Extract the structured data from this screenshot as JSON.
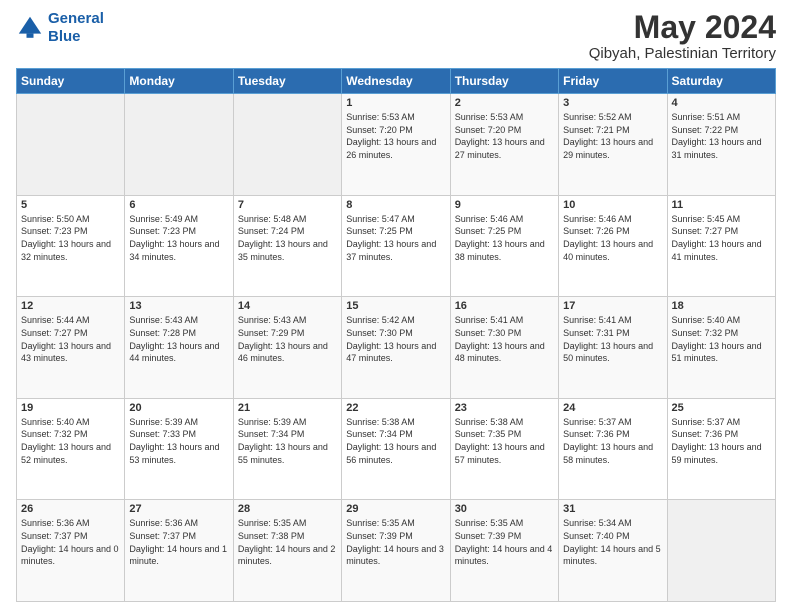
{
  "logo": {
    "line1": "General",
    "line2": "Blue"
  },
  "title": "May 2024",
  "subtitle": "Qibyah, Palestinian Territory",
  "days_header": [
    "Sunday",
    "Monday",
    "Tuesday",
    "Wednesday",
    "Thursday",
    "Friday",
    "Saturday"
  ],
  "weeks": [
    [
      {
        "day": "",
        "sunrise": "",
        "sunset": "",
        "daylight": ""
      },
      {
        "day": "",
        "sunrise": "",
        "sunset": "",
        "daylight": ""
      },
      {
        "day": "",
        "sunrise": "",
        "sunset": "",
        "daylight": ""
      },
      {
        "day": "1",
        "sunrise": "Sunrise: 5:53 AM",
        "sunset": "Sunset: 7:20 PM",
        "daylight": "Daylight: 13 hours and 26 minutes."
      },
      {
        "day": "2",
        "sunrise": "Sunrise: 5:53 AM",
        "sunset": "Sunset: 7:20 PM",
        "daylight": "Daylight: 13 hours and 27 minutes."
      },
      {
        "day": "3",
        "sunrise": "Sunrise: 5:52 AM",
        "sunset": "Sunset: 7:21 PM",
        "daylight": "Daylight: 13 hours and 29 minutes."
      },
      {
        "day": "4",
        "sunrise": "Sunrise: 5:51 AM",
        "sunset": "Sunset: 7:22 PM",
        "daylight": "Daylight: 13 hours and 31 minutes."
      }
    ],
    [
      {
        "day": "5",
        "sunrise": "Sunrise: 5:50 AM",
        "sunset": "Sunset: 7:23 PM",
        "daylight": "Daylight: 13 hours and 32 minutes."
      },
      {
        "day": "6",
        "sunrise": "Sunrise: 5:49 AM",
        "sunset": "Sunset: 7:23 PM",
        "daylight": "Daylight: 13 hours and 34 minutes."
      },
      {
        "day": "7",
        "sunrise": "Sunrise: 5:48 AM",
        "sunset": "Sunset: 7:24 PM",
        "daylight": "Daylight: 13 hours and 35 minutes."
      },
      {
        "day": "8",
        "sunrise": "Sunrise: 5:47 AM",
        "sunset": "Sunset: 7:25 PM",
        "daylight": "Daylight: 13 hours and 37 minutes."
      },
      {
        "day": "9",
        "sunrise": "Sunrise: 5:46 AM",
        "sunset": "Sunset: 7:25 PM",
        "daylight": "Daylight: 13 hours and 38 minutes."
      },
      {
        "day": "10",
        "sunrise": "Sunrise: 5:46 AM",
        "sunset": "Sunset: 7:26 PM",
        "daylight": "Daylight: 13 hours and 40 minutes."
      },
      {
        "day": "11",
        "sunrise": "Sunrise: 5:45 AM",
        "sunset": "Sunset: 7:27 PM",
        "daylight": "Daylight: 13 hours and 41 minutes."
      }
    ],
    [
      {
        "day": "12",
        "sunrise": "Sunrise: 5:44 AM",
        "sunset": "Sunset: 7:27 PM",
        "daylight": "Daylight: 13 hours and 43 minutes."
      },
      {
        "day": "13",
        "sunrise": "Sunrise: 5:43 AM",
        "sunset": "Sunset: 7:28 PM",
        "daylight": "Daylight: 13 hours and 44 minutes."
      },
      {
        "day": "14",
        "sunrise": "Sunrise: 5:43 AM",
        "sunset": "Sunset: 7:29 PM",
        "daylight": "Daylight: 13 hours and 46 minutes."
      },
      {
        "day": "15",
        "sunrise": "Sunrise: 5:42 AM",
        "sunset": "Sunset: 7:30 PM",
        "daylight": "Daylight: 13 hours and 47 minutes."
      },
      {
        "day": "16",
        "sunrise": "Sunrise: 5:41 AM",
        "sunset": "Sunset: 7:30 PM",
        "daylight": "Daylight: 13 hours and 48 minutes."
      },
      {
        "day": "17",
        "sunrise": "Sunrise: 5:41 AM",
        "sunset": "Sunset: 7:31 PM",
        "daylight": "Daylight: 13 hours and 50 minutes."
      },
      {
        "day": "18",
        "sunrise": "Sunrise: 5:40 AM",
        "sunset": "Sunset: 7:32 PM",
        "daylight": "Daylight: 13 hours and 51 minutes."
      }
    ],
    [
      {
        "day": "19",
        "sunrise": "Sunrise: 5:40 AM",
        "sunset": "Sunset: 7:32 PM",
        "daylight": "Daylight: 13 hours and 52 minutes."
      },
      {
        "day": "20",
        "sunrise": "Sunrise: 5:39 AM",
        "sunset": "Sunset: 7:33 PM",
        "daylight": "Daylight: 13 hours and 53 minutes."
      },
      {
        "day": "21",
        "sunrise": "Sunrise: 5:39 AM",
        "sunset": "Sunset: 7:34 PM",
        "daylight": "Daylight: 13 hours and 55 minutes."
      },
      {
        "day": "22",
        "sunrise": "Sunrise: 5:38 AM",
        "sunset": "Sunset: 7:34 PM",
        "daylight": "Daylight: 13 hours and 56 minutes."
      },
      {
        "day": "23",
        "sunrise": "Sunrise: 5:38 AM",
        "sunset": "Sunset: 7:35 PM",
        "daylight": "Daylight: 13 hours and 57 minutes."
      },
      {
        "day": "24",
        "sunrise": "Sunrise: 5:37 AM",
        "sunset": "Sunset: 7:36 PM",
        "daylight": "Daylight: 13 hours and 58 minutes."
      },
      {
        "day": "25",
        "sunrise": "Sunrise: 5:37 AM",
        "sunset": "Sunset: 7:36 PM",
        "daylight": "Daylight: 13 hours and 59 minutes."
      }
    ],
    [
      {
        "day": "26",
        "sunrise": "Sunrise: 5:36 AM",
        "sunset": "Sunset: 7:37 PM",
        "daylight": "Daylight: 14 hours and 0 minutes."
      },
      {
        "day": "27",
        "sunrise": "Sunrise: 5:36 AM",
        "sunset": "Sunset: 7:37 PM",
        "daylight": "Daylight: 14 hours and 1 minute."
      },
      {
        "day": "28",
        "sunrise": "Sunrise: 5:35 AM",
        "sunset": "Sunset: 7:38 PM",
        "daylight": "Daylight: 14 hours and 2 minutes."
      },
      {
        "day": "29",
        "sunrise": "Sunrise: 5:35 AM",
        "sunset": "Sunset: 7:39 PM",
        "daylight": "Daylight: 14 hours and 3 minutes."
      },
      {
        "day": "30",
        "sunrise": "Sunrise: 5:35 AM",
        "sunset": "Sunset: 7:39 PM",
        "daylight": "Daylight: 14 hours and 4 minutes."
      },
      {
        "day": "31",
        "sunrise": "Sunrise: 5:34 AM",
        "sunset": "Sunset: 7:40 PM",
        "daylight": "Daylight: 14 hours and 5 minutes."
      },
      {
        "day": "",
        "sunrise": "",
        "sunset": "",
        "daylight": ""
      }
    ]
  ]
}
